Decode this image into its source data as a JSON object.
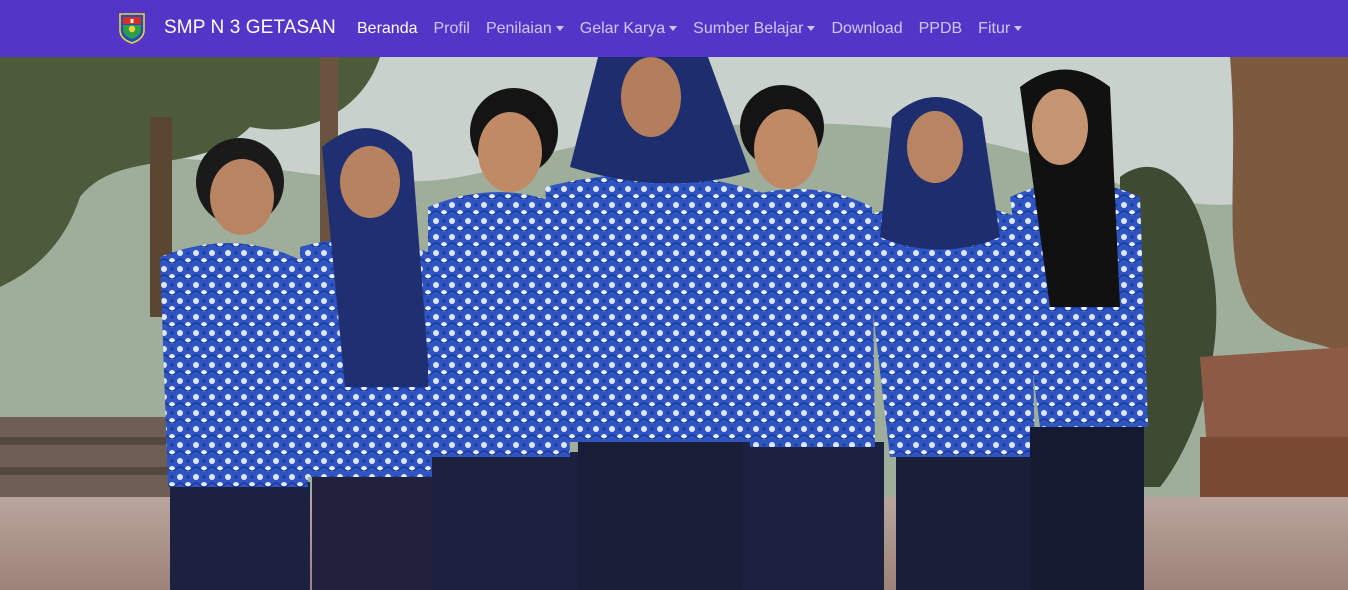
{
  "header": {
    "school_name": "SMP N 3 GETASAN",
    "logo_icon": "school-crest-icon"
  },
  "nav": {
    "items": [
      {
        "label": "Beranda",
        "active": true,
        "dropdown": false
      },
      {
        "label": "Profil",
        "active": false,
        "dropdown": false
      },
      {
        "label": "Penilaian",
        "active": false,
        "dropdown": true
      },
      {
        "label": "Gelar Karya",
        "active": false,
        "dropdown": true
      },
      {
        "label": "Sumber Belajar",
        "active": false,
        "dropdown": true
      },
      {
        "label": "Download",
        "active": false,
        "dropdown": false
      },
      {
        "label": "PPDB",
        "active": false,
        "dropdown": false
      },
      {
        "label": "Fitur",
        "active": false,
        "dropdown": true
      }
    ]
  },
  "hero": {
    "image": "group-photo-of-seven-teachers-in-blue-batik-uniforms"
  },
  "colors": {
    "navbar": "#5335c7",
    "batik_blue": "#2a4fb8",
    "trousers": "#1c2140"
  }
}
